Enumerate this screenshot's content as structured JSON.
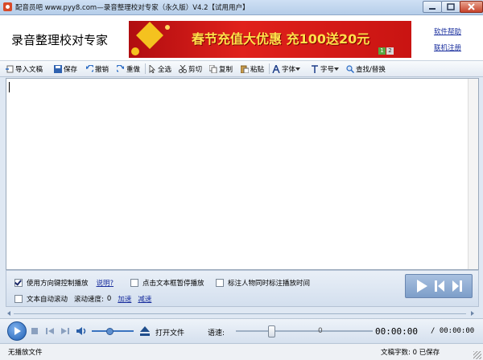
{
  "window": {
    "title": "配音员吧 www.pyy8.com—录音整理校对专家（永久版）V4.2【试用用户】"
  },
  "header": {
    "app_name": "录音整理校对专家",
    "banner_text": "春节充值大优惠 充100送20元",
    "banner_pager": [
      "1",
      "2"
    ],
    "links": [
      "软件帮助",
      "联机注册"
    ]
  },
  "toolbar": {
    "items": [
      {
        "label": "导入文稿",
        "icon": "import-icon"
      },
      {
        "label": "保存",
        "icon": "save-icon"
      },
      {
        "label": "撤销",
        "icon": "undo-icon"
      },
      {
        "label": "重做",
        "icon": "redo-icon"
      },
      {
        "label": "全选",
        "icon": "select-all-icon"
      },
      {
        "label": "剪切",
        "icon": "scissors-icon"
      },
      {
        "label": "复制",
        "icon": "copy-icon"
      },
      {
        "label": "粘贴",
        "icon": "paste-icon"
      },
      {
        "label": "字体",
        "icon": "font-icon"
      },
      {
        "label": "字号",
        "icon": "font-size-icon"
      },
      {
        "label": "查找/替换",
        "icon": "find-icon"
      }
    ]
  },
  "options": {
    "arrow_control": "使用方向键控制播放",
    "help_link": "说明?",
    "click_pause": "点击文本框暂停播放",
    "mark_time": "标注人物同时标注播放时间",
    "auto_scroll": "文本自动滚动",
    "scroll_speed_label": "滚动速度:",
    "scroll_speed_value": "0",
    "speed_up": "加速",
    "slow_down": "减速",
    "checked": {
      "arrow_control": true,
      "click_pause": false,
      "mark_time": false,
      "auto_scroll": false
    }
  },
  "player": {
    "open_file": "打开文件",
    "speed_label": "语速:",
    "speed_value": "0",
    "time_current": "00:00:00",
    "time_total": "/ 00:00:00",
    "volume": 0.4,
    "speed_position": 0.25
  },
  "status": {
    "left": "无播放文件",
    "right": "文稿字数: 0 已保存"
  },
  "colors": {
    "accent": "#1f5fb4",
    "banner": "#e0211b",
    "banner_text": "#ffe14a",
    "link": "#1a2f9e"
  }
}
